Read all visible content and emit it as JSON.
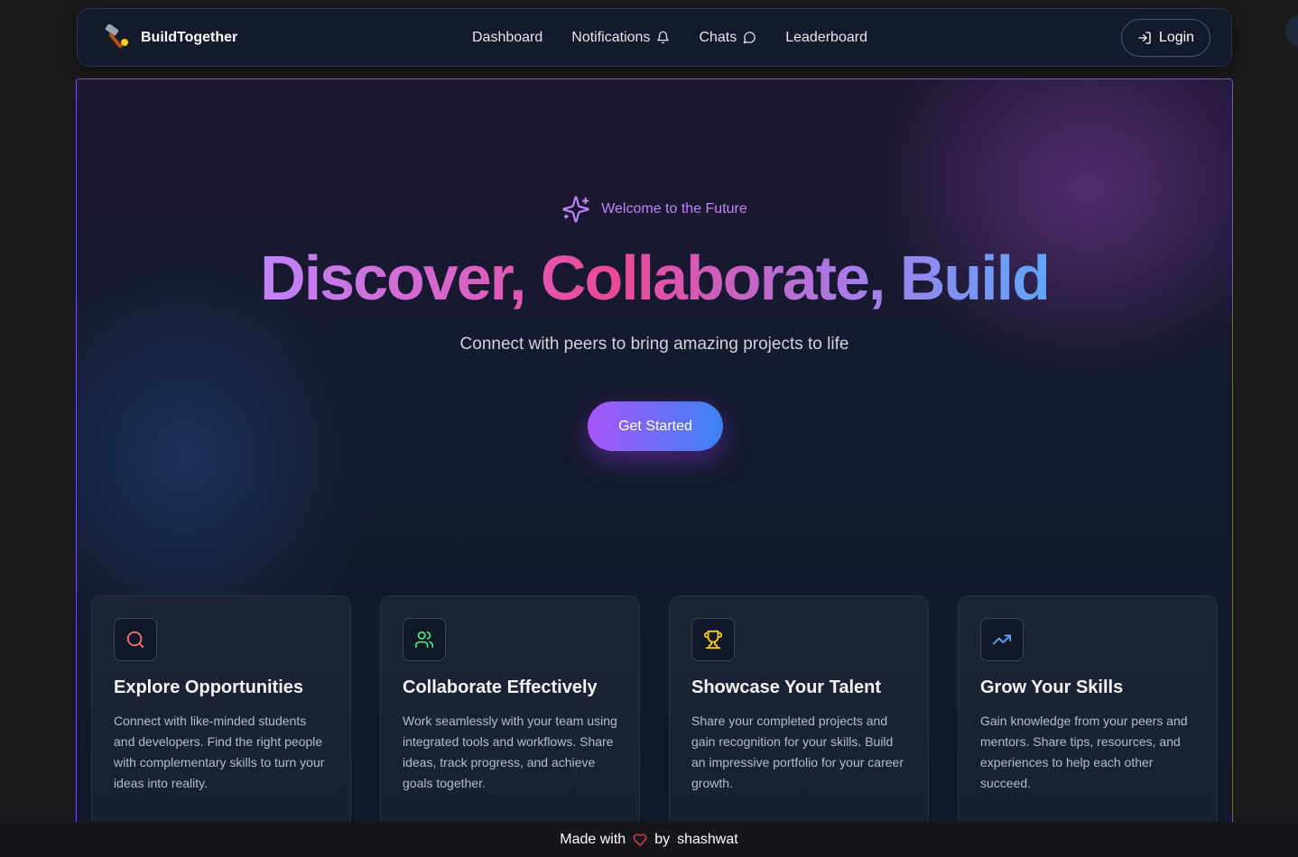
{
  "app": {
    "brand_name": "BuildTogether",
    "brand_icon": "hammer-icon"
  },
  "nav": {
    "links": [
      {
        "label": "Dashboard"
      },
      {
        "label": "Notifications",
        "icon": "bell-icon"
      },
      {
        "label": "Chats",
        "icon": "chat-bubble-icon"
      },
      {
        "label": "Leaderboard"
      }
    ],
    "login_label": "Login",
    "login_icon": "login-arrow-icon"
  },
  "hero": {
    "welcome_text": "Welcome to the Future",
    "welcome_icon": "sparkles-icon",
    "headline": "Discover, Collaborate, Build",
    "subtitle": "Connect with peers to bring amazing projects to life",
    "cta_label": "Get Started"
  },
  "features": [
    {
      "icon": "search-icon",
      "icon_color": "#f87171",
      "title": "Explore Opportunities",
      "text": "Connect with like-minded students and developers. Find the right people with complementary skills to turn your ideas into reality."
    },
    {
      "icon": "users-icon",
      "icon_color": "#4ade80",
      "title": "Collaborate Effectively",
      "text": "Work seamlessly with your team using integrated tools and workflows. Share ideas, track progress, and achieve goals together."
    },
    {
      "icon": "trophy-icon",
      "icon_color": "#facc15",
      "title": "Showcase Your Talent",
      "text": "Share your completed projects and gain recognition for your skills. Build an impressive portfolio for your career growth."
    },
    {
      "icon": "trending-up-icon",
      "icon_color": "#60a5fa",
      "title": "Grow Your Skills",
      "text": "Gain knowledge from your peers and mentors. Share tips, resources, and experiences to help each other succeed."
    }
  ],
  "footer": {
    "prefix": "Made with",
    "suffix": "by",
    "author": "shashwat",
    "heart_color": "#ef4444"
  },
  "colors": {
    "accent_purple": "#a855f7",
    "accent_blue": "#3b82f6",
    "page_bg": "#111827"
  }
}
